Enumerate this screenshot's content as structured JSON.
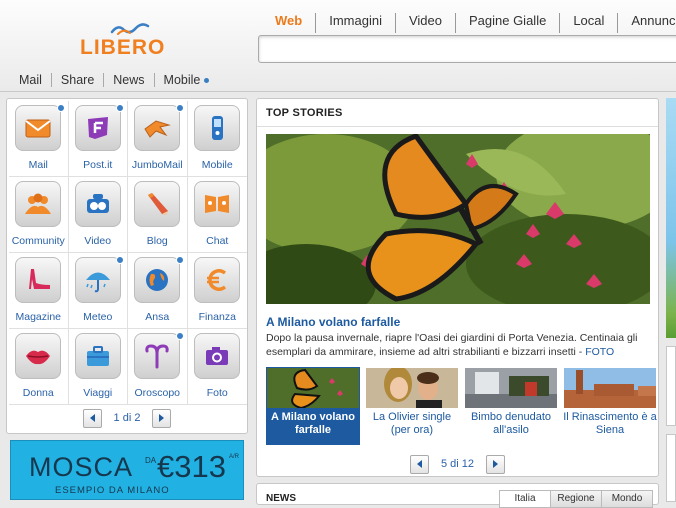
{
  "header": {
    "logo_text": "LIBERO",
    "search_tabs": [
      "Web",
      "Immagini",
      "Video",
      "Pagine Gialle",
      "Local",
      "Annunci"
    ],
    "search_placeholder": "",
    "subnav": [
      "Mail",
      "Share",
      "News",
      "Mobile"
    ]
  },
  "apps": {
    "items": [
      {
        "label": "Mail",
        "icon": "envelope-icon",
        "badge": true
      },
      {
        "label": "Post.it",
        "icon": "post-it-icon",
        "badge": true
      },
      {
        "label": "JumboMail",
        "icon": "jumbomail-icon",
        "badge": true
      },
      {
        "label": "Mobile",
        "icon": "mobile-phone-icon",
        "badge": false
      },
      {
        "label": "Community",
        "icon": "community-icon",
        "badge": false
      },
      {
        "label": "Video",
        "icon": "video-camera-icon",
        "badge": false
      },
      {
        "label": "Blog",
        "icon": "pencil-icon",
        "badge": false
      },
      {
        "label": "Chat",
        "icon": "chat-icon",
        "badge": false
      },
      {
        "label": "Magazine",
        "icon": "high-heel-icon",
        "badge": false
      },
      {
        "label": "Meteo",
        "icon": "umbrella-icon",
        "badge": true
      },
      {
        "label": "Ansa",
        "icon": "globe-icon",
        "badge": true
      },
      {
        "label": "Finanza",
        "icon": "euro-icon",
        "badge": false
      },
      {
        "label": "Donna",
        "icon": "lips-icon",
        "badge": false
      },
      {
        "label": "Viaggi",
        "icon": "suitcase-icon",
        "badge": false
      },
      {
        "label": "Oroscopo",
        "icon": "aries-icon",
        "badge": true
      },
      {
        "label": "Foto",
        "icon": "photo-camera-icon",
        "badge": false
      }
    ],
    "pager": "1 di 2"
  },
  "ad": {
    "city": "MOSCA",
    "from": "DA",
    "price": "€313",
    "ar": "A/R",
    "subtitle": "ESEMPIO DA MILANO"
  },
  "stories": {
    "title": "TOP STORIES",
    "headline": "A Milano volano farfalle",
    "summary": "Dopo la pausa invernale, riapre l'Oasi dei giardini di Porta Venezia. Centinaia gli esemplari da ammirare, insieme ad altri strabilianti e bizzarri insetti - ",
    "summary_link": "FOTO",
    "thumbs": [
      {
        "caption": "A Milano volano farfalle",
        "selected": true
      },
      {
        "caption": "La Olivier single (per ora)",
        "selected": false
      },
      {
        "caption": "Bimbo denudato all'asilo",
        "selected": false
      },
      {
        "caption": "Il Rinascimento è a Siena",
        "selected": false
      }
    ],
    "pager": "5 di 12"
  },
  "news": {
    "title": "NEWS",
    "tabs": [
      "Italia",
      "Regione",
      "Mondo"
    ]
  },
  "colors": {
    "brand_orange": "#f07f1f",
    "link_blue": "#1d5aa0",
    "ad_cyan": "#22b1e3"
  }
}
